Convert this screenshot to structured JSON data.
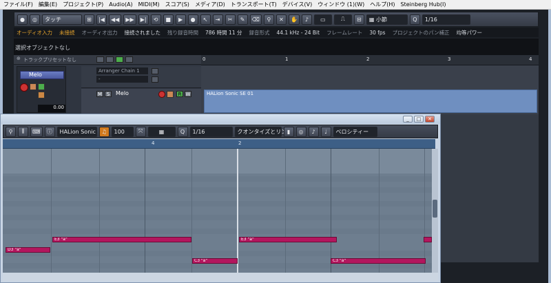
{
  "menu": [
    "ファイル(F)",
    "編集(E)",
    "プロジェクト(P)",
    "Audio(A)",
    "MIDI(M)",
    "スコア(S)",
    "メディア(D)",
    "トランスポート(T)",
    "デバイス(V)",
    "ウィンドウ (1)(W)",
    "ヘルプ(H)",
    "Steinberg Hub(I)"
  ],
  "toolbar": {
    "touch_mode": "タッチ",
    "snap_type": "小節",
    "quantize": "1/16"
  },
  "status": {
    "audio_in_label": "オーディオ入力",
    "audio_in_value": "未接続",
    "audio_out_label": "オーディオ出力",
    "audio_out_value": "接続されました",
    "rec_time_label": "残り録音時間",
    "rec_time_value": "786 時間 11 分",
    "rec_format_label": "録音形式",
    "rec_format_value": "44.1 kHz - 24 Bit",
    "frame_rate_label": "フレームレート",
    "frame_rate_value": "30 fps",
    "pan_label": "プロジェクトのパン補正",
    "pan_value": "均等パワー"
  },
  "info_line": "選択オブジェクトなし",
  "track_header": "トラックプリセットなし",
  "tracks": [
    {
      "name": "Melo",
      "volume": "0.00"
    },
    {
      "chain": "Arranger Chain 1",
      "dash": "-"
    },
    {
      "name": "Melo",
      "m": "M",
      "s": "S",
      "r": "R",
      "w": "W"
    }
  ],
  "ruler_marks": [
    "0",
    "1",
    "2",
    "3",
    "4"
  ],
  "event_name": "HALion Sonic SE 01",
  "editor": {
    "instrument": "HALion Sonic",
    "velocity": "100",
    "quantize": "1/16",
    "quantize_mode": "クオンタイズとリン",
    "controller_lane": "ベロシティー",
    "ruler_marks": [
      "4",
      "2"
    ],
    "notes": [
      "D3 \"a\"",
      "E3 \"a\"",
      "C3 \"a\"",
      "E3 \"a\"",
      "C3 \"a\""
    ]
  }
}
